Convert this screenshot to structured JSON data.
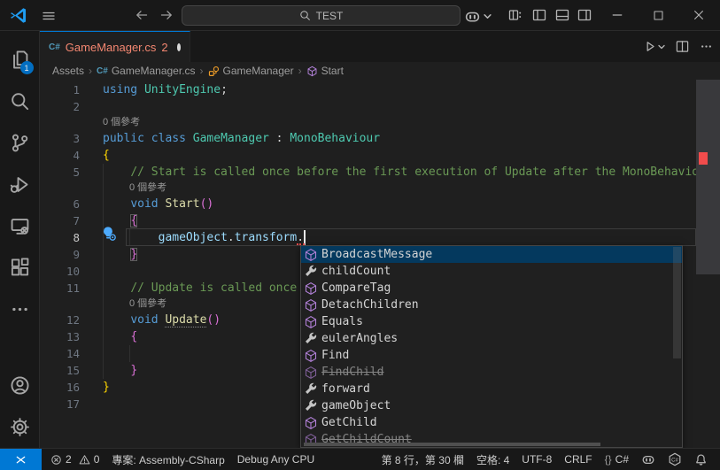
{
  "colors": {
    "accent": "#0078d4",
    "error": "#f14c4c",
    "tab_error_foreground": "#f48771",
    "editor_background": "#1f1f1f",
    "chrome_background": "#181818",
    "suggest_selected_background": "#04395e",
    "method_icon": "#b180d7",
    "property_icon": "#c5c5c5",
    "class_icon": "#ee9d28"
  },
  "titlebar": {
    "search_value": "TEST",
    "icons": [
      "vscode-logo",
      "menu",
      "back-arrow",
      "forward-arrow",
      "copilot",
      "customize-layout",
      "toggle-primary-sidebar",
      "toggle-panel",
      "toggle-secondary-sidebar",
      "minimize",
      "maximize",
      "close"
    ]
  },
  "tab": {
    "file": "GameManager.cs",
    "error_count": "2",
    "modified": true,
    "actions": [
      "run",
      "split-editor",
      "more-actions"
    ]
  },
  "breadcrumbs": {
    "items": [
      "Assets",
      "GameManager.cs",
      "GameManager",
      "Start"
    ]
  },
  "activity_bar": {
    "explorer_badge": "1",
    "icons": [
      "explorer",
      "search",
      "source-control",
      "run-and-debug",
      "remote-explorer",
      "extensions",
      "more-views",
      "accounts",
      "settings-gear"
    ]
  },
  "editor": {
    "codelens_label": "0 個參考",
    "rows": [
      {
        "n": "1",
        "tokens": [
          [
            "kw",
            "using"
          ],
          [
            "pl",
            " "
          ],
          [
            "ty",
            "UnityEngine"
          ],
          [
            "pl",
            ";"
          ]
        ]
      },
      {
        "n": "2",
        "tokens": []
      },
      {
        "lens": "0 個參考",
        "indent": 0
      },
      {
        "n": "3",
        "tokens": [
          [
            "kw",
            "public"
          ],
          [
            "pl",
            " "
          ],
          [
            "kw",
            "class"
          ],
          [
            "pl",
            " "
          ],
          [
            "ty",
            "GameManager"
          ],
          [
            "pl",
            " : "
          ],
          [
            "ty",
            "MonoBehaviour"
          ]
        ]
      },
      {
        "n": "4",
        "tokens": [
          [
            "b1",
            "{"
          ]
        ]
      },
      {
        "n": "5",
        "tokens": [
          [
            "pl",
            "    "
          ],
          [
            "cm",
            "// Start is called once before the first execution of Update after the MonoBehaviour is created"
          ]
        ]
      },
      {
        "lens": "0 個參考",
        "indent": 1
      },
      {
        "n": "6",
        "tokens": [
          [
            "pl",
            "    "
          ],
          [
            "kw",
            "void"
          ],
          [
            "pl",
            " "
          ],
          [
            "fn",
            "Start"
          ],
          [
            "b2",
            "()"
          ]
        ]
      },
      {
        "n": "7",
        "tokens": [
          [
            "pl",
            "    "
          ],
          [
            "b2m",
            "{"
          ]
        ]
      },
      {
        "n": "8",
        "cur": true,
        "tokens": [
          [
            "pl",
            "        "
          ],
          [
            "vr",
            "gameObject"
          ],
          [
            "pl",
            "."
          ],
          [
            "vr",
            "transform"
          ],
          [
            "pl",
            "."
          ]
        ]
      },
      {
        "n": "9",
        "tokens": [
          [
            "pl",
            "    "
          ],
          [
            "b2m",
            "}"
          ]
        ]
      },
      {
        "n": "10",
        "tokens": []
      },
      {
        "n": "11",
        "tokens": [
          [
            "pl",
            "    "
          ],
          [
            "cm",
            "// Update is called once per frame"
          ]
        ]
      },
      {
        "lens": "0 個參考",
        "indent": 1
      },
      {
        "n": "12",
        "tokens": [
          [
            "pl",
            "    "
          ],
          [
            "kw",
            "void"
          ],
          [
            "pl",
            " "
          ],
          [
            "fnu",
            "Update"
          ],
          [
            "b2",
            "()"
          ]
        ]
      },
      {
        "n": "13",
        "tokens": [
          [
            "pl",
            "    "
          ],
          [
            "b2",
            "{"
          ]
        ]
      },
      {
        "n": "14",
        "tokens": []
      },
      {
        "n": "15",
        "tokens": [
          [
            "pl",
            "    "
          ],
          [
            "b2",
            "}"
          ]
        ]
      },
      {
        "n": "16",
        "tokens": [
          [
            "b1",
            "}"
          ]
        ]
      },
      {
        "n": "17",
        "tokens": []
      }
    ]
  },
  "suggest": {
    "items": [
      {
        "kind": "method",
        "label": "BroadcastMessage",
        "selected": true
      },
      {
        "kind": "property",
        "label": "childCount"
      },
      {
        "kind": "method",
        "label": "CompareTag"
      },
      {
        "kind": "method",
        "label": "DetachChildren"
      },
      {
        "kind": "method",
        "label": "Equals"
      },
      {
        "kind": "property",
        "label": "eulerAngles"
      },
      {
        "kind": "method",
        "label": "Find"
      },
      {
        "kind": "method",
        "label": "FindChild",
        "deprecated": true
      },
      {
        "kind": "property",
        "label": "forward"
      },
      {
        "kind": "property",
        "label": "gameObject"
      },
      {
        "kind": "method",
        "label": "GetChild"
      },
      {
        "kind": "method",
        "label": "GetChildCount",
        "deprecated": true
      }
    ]
  },
  "status_bar": {
    "errors": "2",
    "warnings": "0",
    "project": "專案: Assembly-CSharp",
    "config": "Debug Any CPU",
    "cursor_position": "第 8 行，第 30 欄",
    "indentation": "空格: 4",
    "encoding": "UTF-8",
    "eol": "CRLF",
    "brackets": "{}",
    "language": "C#",
    "icons": [
      "remote-indicator",
      "error",
      "warning",
      "copilot",
      "csharp-extension",
      "bell"
    ]
  }
}
